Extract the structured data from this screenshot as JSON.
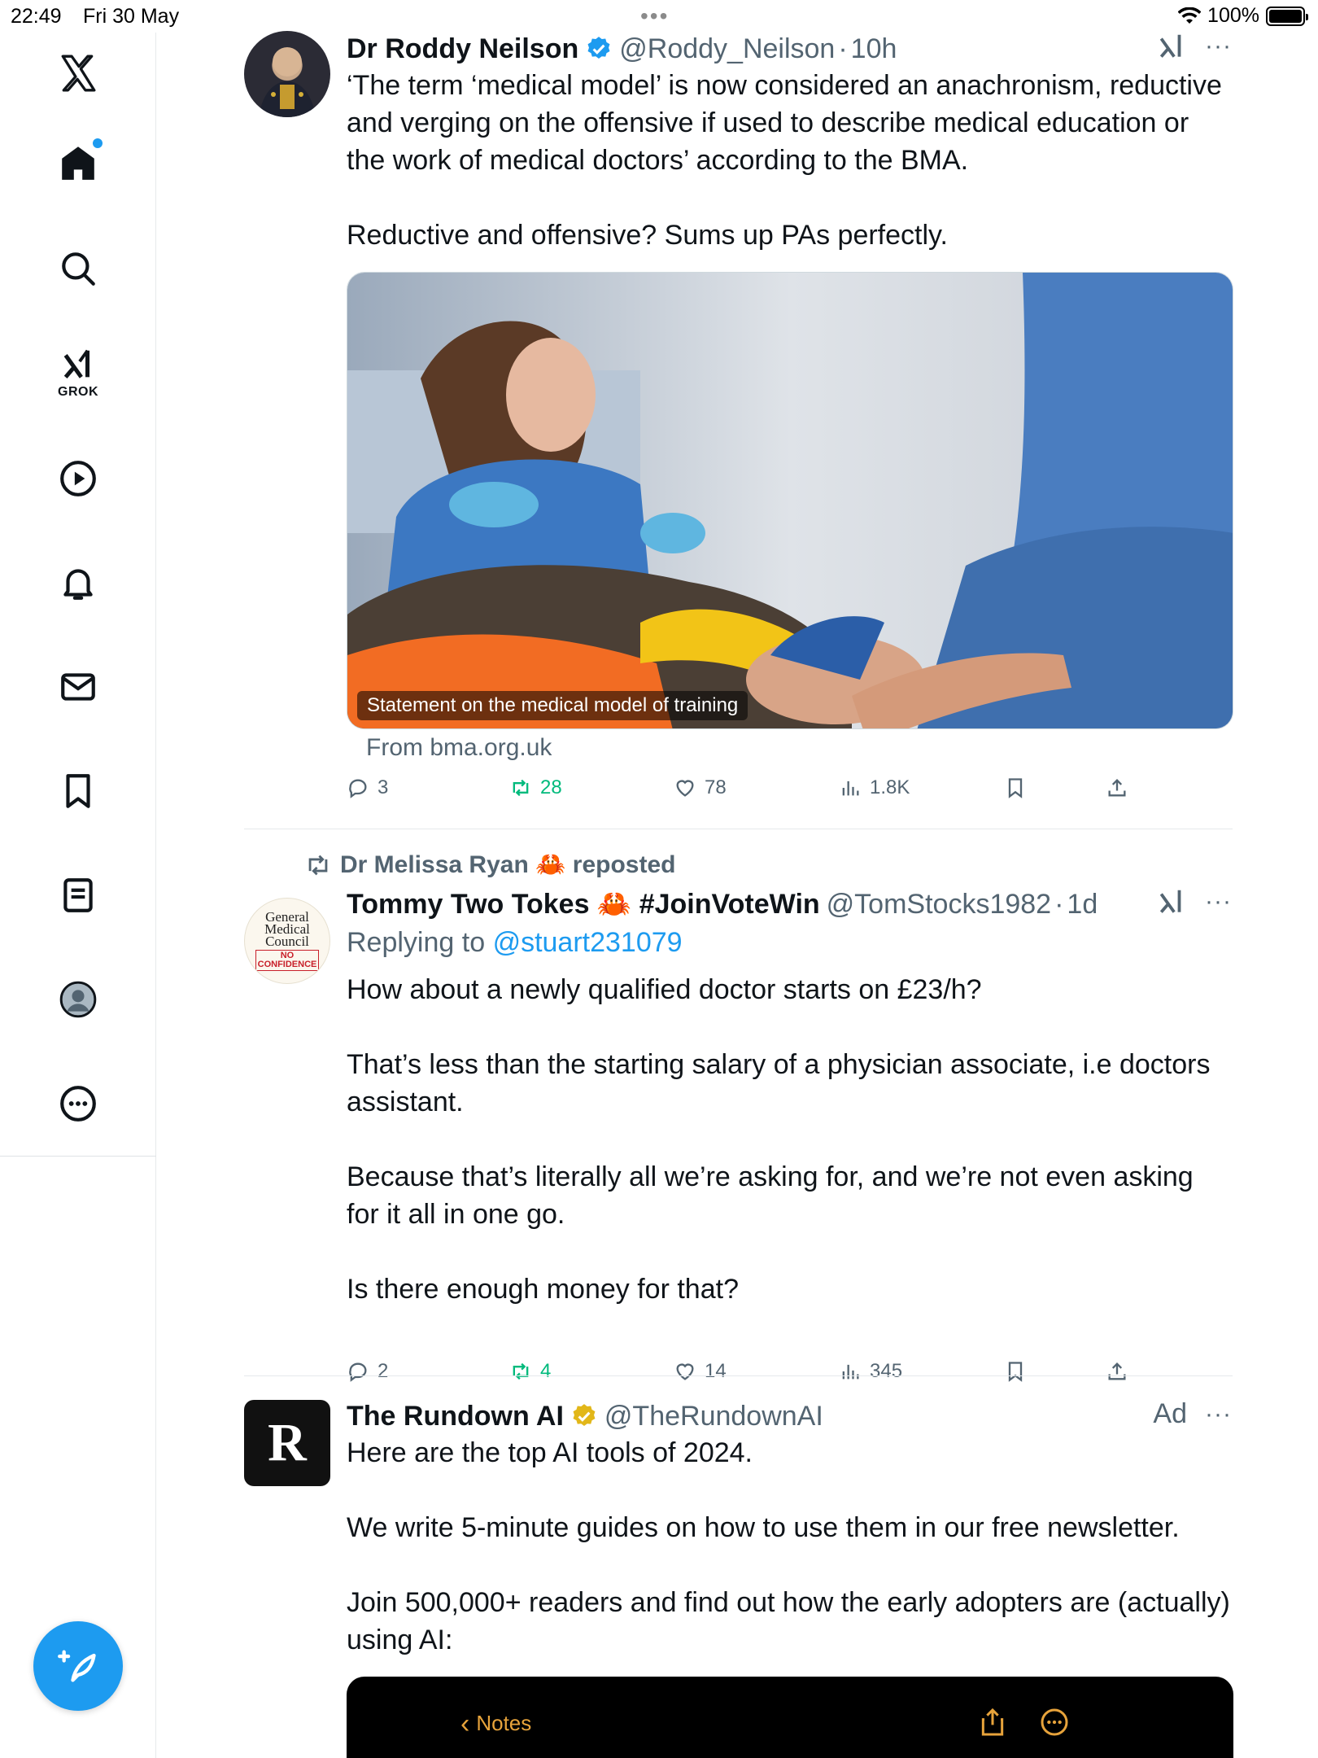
{
  "status_bar": {
    "time": "22:49",
    "date": "Fri 30 May",
    "battery": "100%"
  },
  "sidebar": {
    "logo": "x-logo-icon",
    "items": [
      {
        "name": "home",
        "icon": "home-icon"
      },
      {
        "name": "search",
        "icon": "search-icon"
      },
      {
        "name": "grok",
        "icon": "grok-icon",
        "label": "GROK"
      },
      {
        "name": "videos",
        "icon": "play-icon"
      },
      {
        "name": "notifications",
        "icon": "bell-icon"
      },
      {
        "name": "messages",
        "icon": "mail-icon"
      },
      {
        "name": "bookmarks",
        "icon": "bookmark-icon"
      },
      {
        "name": "lists",
        "icon": "list-icon"
      },
      {
        "name": "profile",
        "icon": "avatar-icon"
      },
      {
        "name": "more",
        "icon": "more-circle-icon"
      }
    ],
    "compose_icon": "compose-icon"
  },
  "tweets": [
    {
      "name": "Dr Roddy Neilson",
      "handle": "@Roddy_Neilson",
      "time": "10h",
      "verified": "blue",
      "text": [
        "‘The term ‘medical model’ is now considered an anachronism, reductive and verging on the offensive if used to describe medical education or the work of medical doctors’ according to the BMA.",
        "Reductive and offensive? Sums up PAs perfectly."
      ],
      "media_caption": "Statement on the medical model of training",
      "from": "From bma.org.uk",
      "stats": {
        "replies": "3",
        "reposts": "28",
        "likes": "78",
        "views": "1.8K"
      }
    },
    {
      "reposted_by": "Dr Melissa Ryan 🦀 reposted",
      "name": "Tommy Two Tokes 🦀 #JoinVoteWin",
      "handle": "@TomStocks1982",
      "time": "1d",
      "replying_label": "Replying to",
      "replying_to": "@stuart231079",
      "avatar_text": [
        "General",
        "Medical",
        "Council"
      ],
      "avatar_stamp": [
        "NO",
        "CONFIDENCE"
      ],
      "text": [
        "How about a newly qualified doctor starts on £23/h?",
        "That’s less than the starting salary of a physician associate, i.e doctors assistant.",
        "Because that’s literally all we’re asking for, and we’re not even asking for it all in one go.",
        "Is there enough money for that?"
      ],
      "stats": {
        "replies": "2",
        "reposts": "4",
        "likes": "14",
        "views": "345"
      }
    },
    {
      "name": "The Rundown AI",
      "handle": "@TheRundownAI",
      "verified": "gold",
      "ad_label": "Ad",
      "avatar_text": "R",
      "text": [
        "Here are the top AI tools of 2024.",
        "We write 5-minute guides on how to use them in our free newsletter.",
        "Join 500,000+ readers and find out how the early adopters are (actually) using AI:"
      ],
      "media_back_label": "Notes"
    }
  ],
  "colors": {
    "accent": "#1d9bf0",
    "repost": "#00ba7c",
    "muted": "#536471",
    "gold": "#e2b719"
  }
}
